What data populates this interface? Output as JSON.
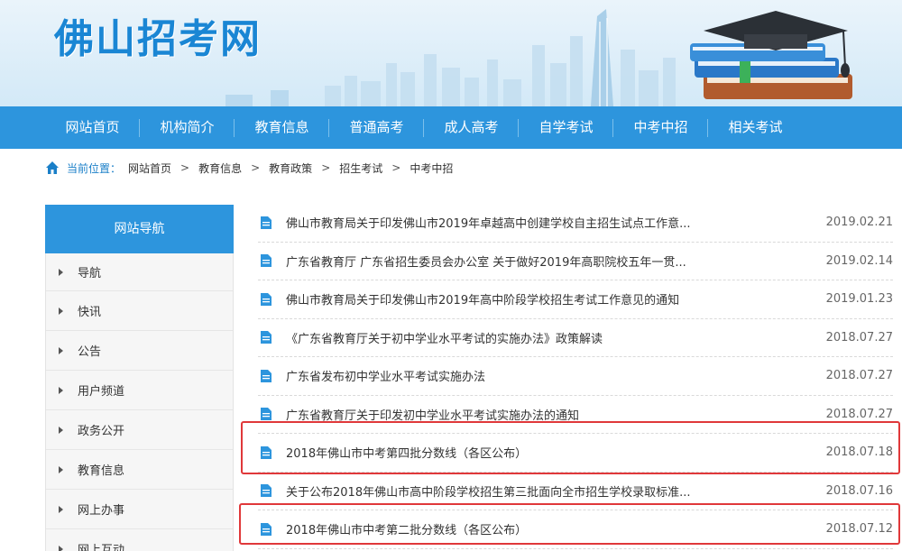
{
  "header": {
    "site_title": "佛山招考网"
  },
  "nav": {
    "items": [
      {
        "label": "网站首页"
      },
      {
        "label": "机构简介"
      },
      {
        "label": "教育信息"
      },
      {
        "label": "普通高考"
      },
      {
        "label": "成人高考"
      },
      {
        "label": "自学考试"
      },
      {
        "label": "中考中招"
      },
      {
        "label": "相关考试"
      }
    ]
  },
  "breadcrumb": {
    "label": "当前位置：",
    "items": [
      "网站首页",
      "教育信息",
      "教育政策",
      "招生考试",
      "中考中招"
    ],
    "separator": ">"
  },
  "sidebar": {
    "title": "网站导航",
    "items": [
      {
        "label": "导航"
      },
      {
        "label": "快讯"
      },
      {
        "label": "公告"
      },
      {
        "label": "用户频道"
      },
      {
        "label": "政务公开"
      },
      {
        "label": "教育信息"
      },
      {
        "label": "网上办事"
      },
      {
        "label": "网上互动"
      }
    ]
  },
  "articles": [
    {
      "title": "佛山市教育局关于印发佛山市2019年卓越高中创建学校自主招生试点工作意...",
      "date": "2019.02.21",
      "highlighted": false
    },
    {
      "title": "广东省教育厅 广东省招生委员会办公室 关于做好2019年高职院校五年一贯...",
      "date": "2019.02.14",
      "highlighted": false
    },
    {
      "title": "佛山市教育局关于印发佛山市2019年高中阶段学校招生考试工作意见的通知",
      "date": "2019.01.23",
      "highlighted": false
    },
    {
      "title": "《广东省教育厅关于初中学业水平考试的实施办法》政策解读",
      "date": "2018.07.27",
      "highlighted": false
    },
    {
      "title": "广东省发布初中学业水平考试实施办法",
      "date": "2018.07.27",
      "highlighted": false
    },
    {
      "title": "广东省教育厅关于印发初中学业水平考试实施办法的通知",
      "date": "2018.07.27",
      "highlighted": false
    },
    {
      "title": "2018年佛山市中考第四批分数线（各区公布）",
      "date": "2018.07.18",
      "highlighted": true
    },
    {
      "title": "关于公布2018年佛山市高中阶段学校招生第三批面向全市招生学校录取标准...",
      "date": "2018.07.16",
      "highlighted": false
    },
    {
      "title": "2018年佛山市中考第二批分数线（各区公布）",
      "date": "2018.07.12",
      "highlighted": true
    }
  ],
  "colors": {
    "brand_blue": "#2d95dd",
    "title_blue": "#1a86d4",
    "highlight_red": "#e0383a"
  }
}
